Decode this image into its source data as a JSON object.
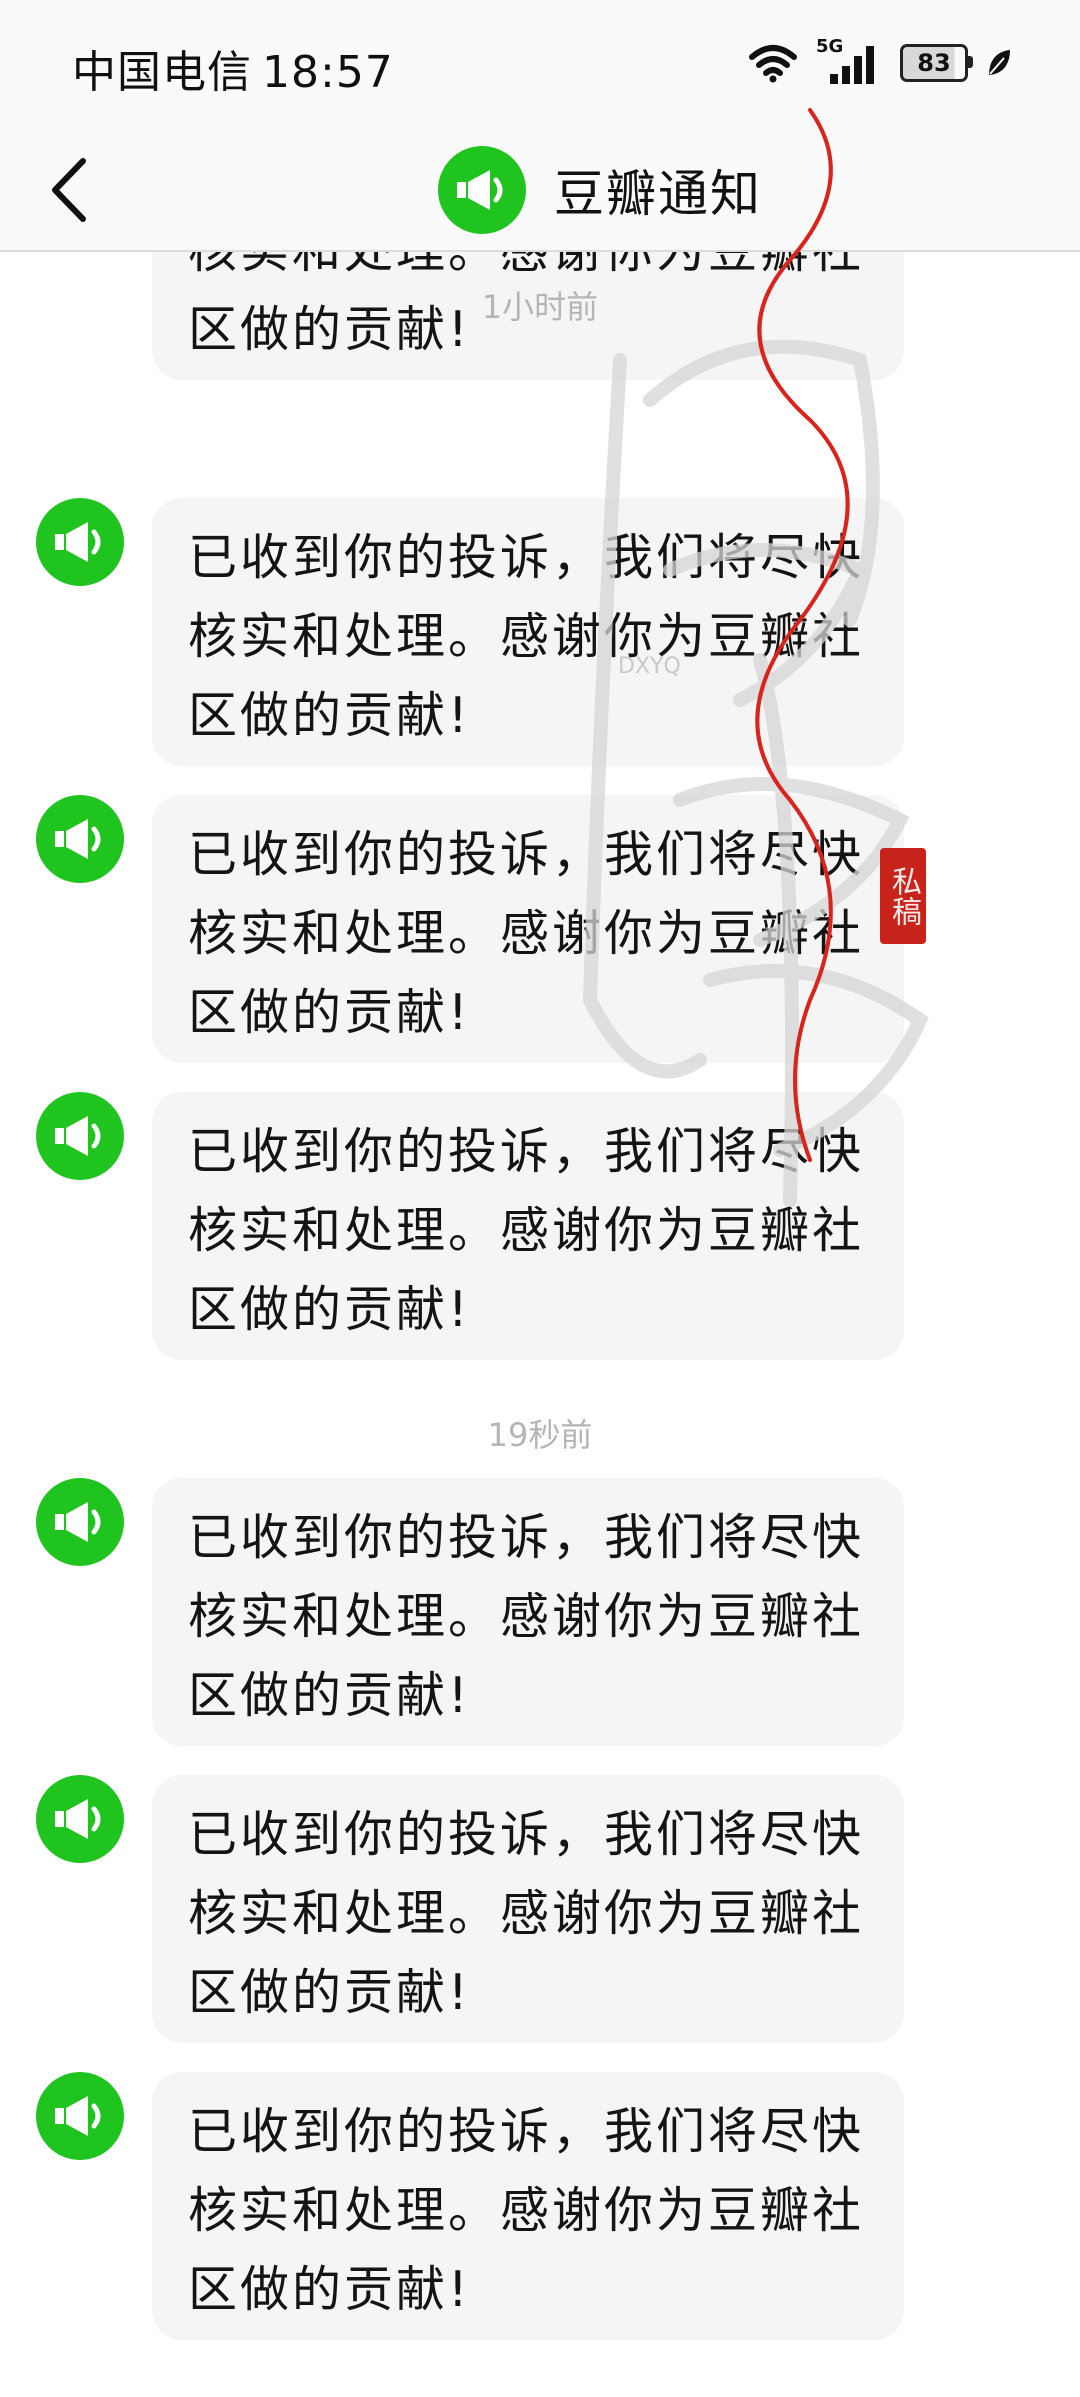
{
  "status_bar": {
    "carrier": "中国电信",
    "time": "18:57",
    "network": "5G",
    "battery": "83",
    "battery_level": 0.83,
    "icons": [
      "wifi-icon",
      "cellular-signal-icon",
      "battery-icon",
      "leaf-icon"
    ]
  },
  "header": {
    "title": "豆瓣通知",
    "avatar_icon": "megaphone-icon",
    "back_icon": "chevron-left-icon",
    "accent_color": "#1fc41f"
  },
  "chat": {
    "partial_message": {
      "line2": "核实和处理。感谢你为豆瓣社",
      "line3": "区做的贡献!"
    },
    "groups": [
      {
        "time": "1小时前",
        "messages": [
          {
            "line1": "已收到你的投诉，我们将尽快",
            "line2": "核实和处理。感谢你为豆瓣社",
            "line3": "区做的贡献!"
          },
          {
            "line1": "已收到你的投诉，我们将尽快",
            "line2": "核实和处理。感谢你为豆瓣社",
            "line3": "区做的贡献!"
          },
          {
            "line1": "已收到你的投诉，我们将尽快",
            "line2": "核实和处理。感谢你为豆瓣社",
            "line3": "区做的贡献!"
          }
        ]
      },
      {
        "time": "19秒前",
        "messages": [
          {
            "line1": "已收到你的投诉，我们将尽快",
            "line2": "核实和处理。感谢你为豆瓣社",
            "line3": "区做的贡献!"
          },
          {
            "line1": "已收到你的投诉，我们将尽快",
            "line2": "核实和处理。感谢你为豆瓣社",
            "line3": "区做的贡献!"
          },
          {
            "line1": "已收到你的投诉，我们将尽快",
            "line2": "核实和处理。感谢你为豆瓣社",
            "line3": "区做的贡献!"
          }
        ]
      }
    ]
  },
  "watermark": {
    "seal_text": "私稿",
    "letters": "DXYQ"
  }
}
